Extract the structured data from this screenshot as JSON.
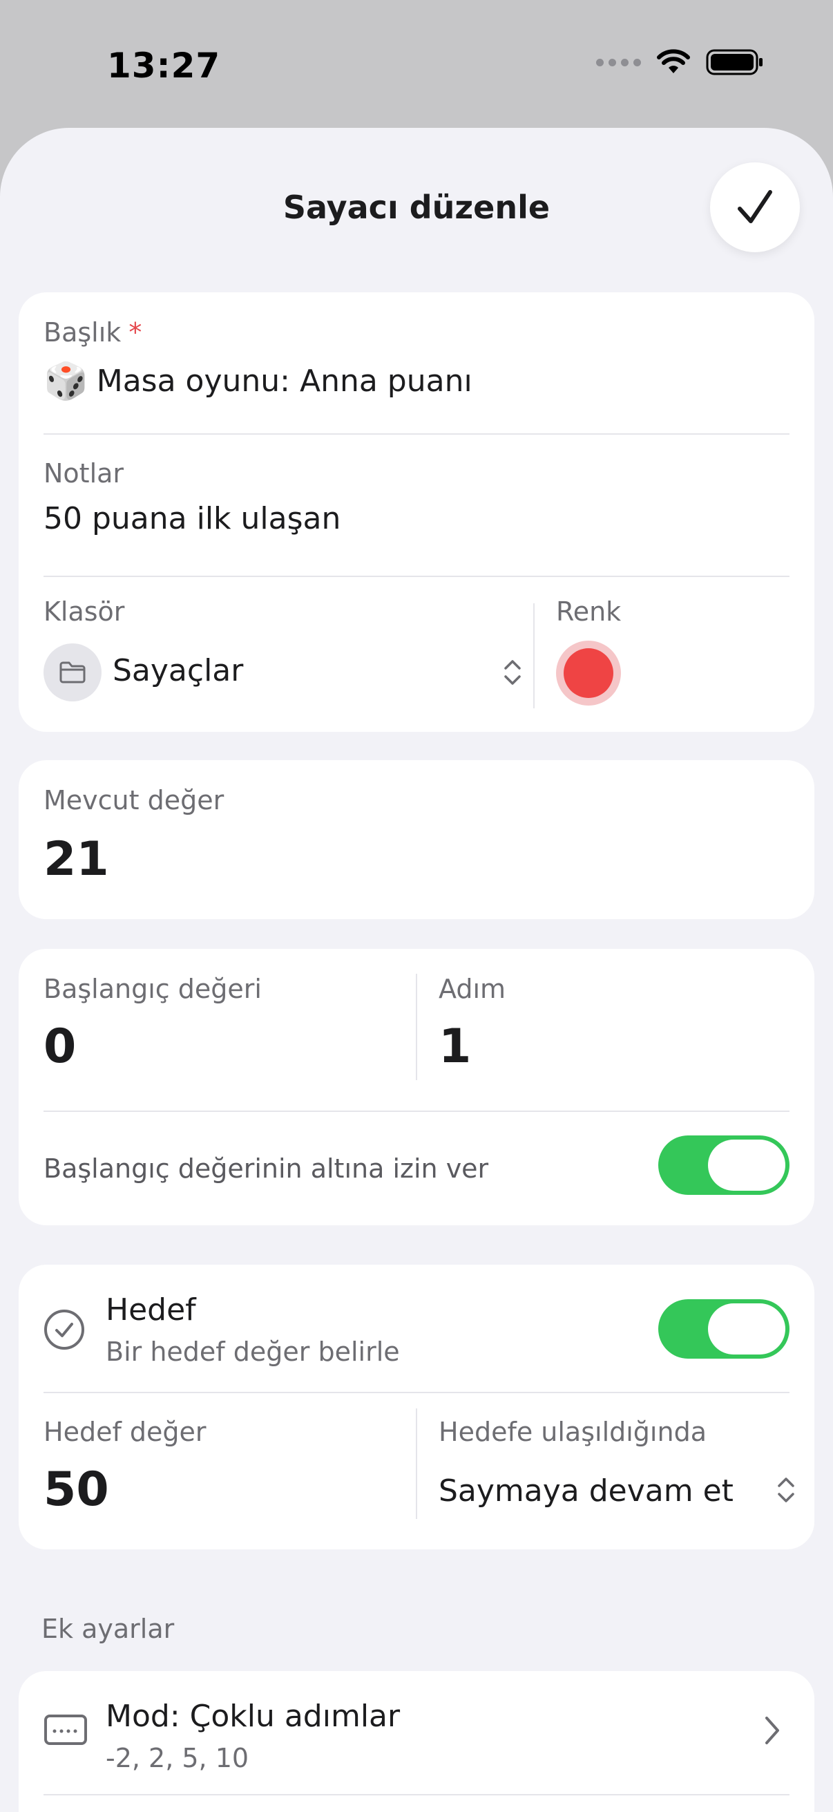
{
  "status_bar": {
    "time": "13:27"
  },
  "header": {
    "title": "Sayacı düzenle"
  },
  "title_field": {
    "label": "Başlık",
    "required_mark": "*",
    "emoji": "🎲",
    "value": "Masa oyunu: Anna puanı"
  },
  "notes_field": {
    "label": "Notlar",
    "value": "50 puana ilk ulaşan"
  },
  "folder_field": {
    "label": "Klasör",
    "value": "Sayaçlar"
  },
  "color_field": {
    "label": "Renk",
    "color": "#ef4444"
  },
  "current_value": {
    "label": "Mevcut değer",
    "value": "21"
  },
  "start_value": {
    "label": "Başlangıç değeri",
    "value": "0"
  },
  "step": {
    "label": "Adım",
    "value": "1"
  },
  "allow_below": {
    "label": "Başlangıç değerinin altına izin ver",
    "enabled": true
  },
  "goal": {
    "title": "Hedef",
    "subtitle": "Bir hedef değer belirle",
    "enabled": true,
    "target_label": "Hedef değer",
    "target_value": "50",
    "on_reach_label": "Hedefe ulaşıldığında",
    "on_reach_value": "Saymaya devam et"
  },
  "extra": {
    "section_label": "Ek ayarlar",
    "mode_title": "Mod: Çoklu adımlar",
    "mode_subtitle": "-2, 2, 5, 10"
  },
  "colors": {
    "accent_green": "#34c759",
    "sheet_bg": "#f2f2f7",
    "card_bg": "#ffffff",
    "red": "#ef4444"
  }
}
